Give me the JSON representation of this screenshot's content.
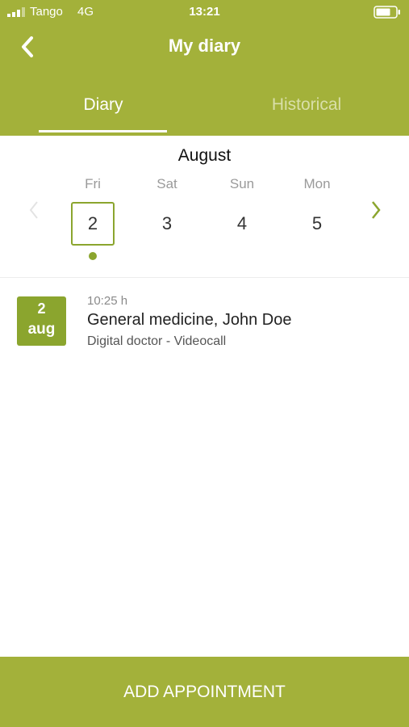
{
  "status_bar": {
    "carrier": "Tango",
    "network": "4G",
    "time": "13:21"
  },
  "header": {
    "title": "My diary",
    "back_icon": "chevron-left-icon"
  },
  "tabs": [
    {
      "label": "Diary",
      "active": true
    },
    {
      "label": "Historical",
      "active": false
    }
  ],
  "calendar": {
    "month": "August",
    "prev_icon": "chevron-left-icon",
    "next_icon": "chevron-right-icon",
    "days": [
      {
        "name": "Fri",
        "number": "2",
        "selected": true,
        "has_event": true
      },
      {
        "name": "Sat",
        "number": "3",
        "selected": false,
        "has_event": false
      },
      {
        "name": "Sun",
        "number": "4",
        "selected": false,
        "has_event": false
      },
      {
        "name": "Mon",
        "number": "5",
        "selected": false,
        "has_event": false
      }
    ]
  },
  "appointments": [
    {
      "badge_day": "2",
      "badge_month": "aug",
      "time": "10:25 h",
      "title": "General medicine, John Doe",
      "subtitle": "Digital doctor - Videocall"
    }
  ],
  "footer": {
    "add_label": "ADD APPOINTMENT"
  },
  "colors": {
    "accent": "#a3b13a",
    "accent_dark": "#8ba52e",
    "inactive_tab": "#d9dfa9"
  }
}
